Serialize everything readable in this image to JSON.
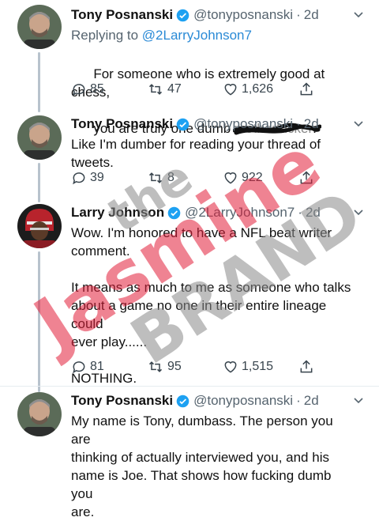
{
  "tweets": [
    {
      "name": "Tony Posnanski",
      "handle": "@tonyposnanski",
      "time": "2d",
      "replying_prefix": "Replying to",
      "replying_handle": "@2LarryJohnson7",
      "text_line1": "For someone who is extremely good at chess,",
      "text_line2_pre": "you are truly one dumb ",
      "text_line2_censored": "motherfucker",
      "text_line2_post": ".",
      "replies": "85",
      "retweets": "47",
      "likes": "1,626"
    },
    {
      "name": "Tony Posnanski",
      "handle": "@tonyposnanski",
      "time": "2d",
      "text": "Like I'm dumber for reading your thread of\ntweets.",
      "replies": "39",
      "retweets": "8",
      "likes": "922"
    },
    {
      "name": "Larry Johnson",
      "handle": "@2LarryJohnson7",
      "time": "2d",
      "text": "Wow. I'm honored to have a NFL beat writer\ncomment.\n\nIt means as much to me as someone who talks\nabout a game no one in their entire lineage could\never play......\n\nNOTHING.",
      "replies": "81",
      "retweets": "95",
      "likes": "1,515"
    },
    {
      "name": "Tony Posnanski",
      "handle": "@tonyposnanski",
      "time": "2d",
      "text": "My name is Tony, dumbass. The person you are\nthinking of actually interviewed you, and his\nname is Joe. That shows how fucking dumb you\nare."
    }
  ],
  "separator": "·",
  "icons": [
    "verified-badge-icon",
    "chevron-down-icon",
    "reply-icon",
    "retweet-icon",
    "like-icon",
    "share-icon"
  ],
  "colors": {
    "accent": "#2a8ad6",
    "verified": "#1da1f2",
    "watermark_red": "#e21f3a",
    "watermark_gray": "#8a8a8a"
  },
  "watermark": {
    "line1": "the",
    "line2": "Jasmine",
    "line3": "BRAND"
  }
}
